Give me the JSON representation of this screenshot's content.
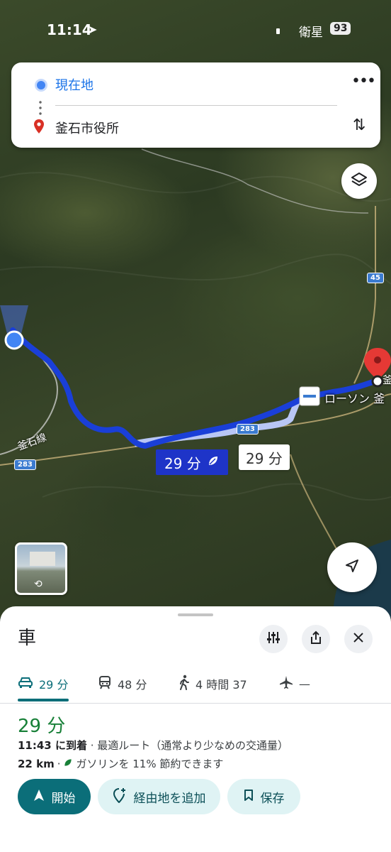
{
  "status_bar": {
    "time": "11:14",
    "carrier": "衛星",
    "battery": "93"
  },
  "directions": {
    "origin": "現在地",
    "destination": "釜石市役所",
    "more_label": "•••"
  },
  "map": {
    "route_primary_time": "29 分",
    "route_alt_time": "29 分",
    "poi_label": "ローソン 釜",
    "dest_label": "釜",
    "rail_label": "釜石線",
    "shield_283_a": "283",
    "shield_283_b": "283",
    "shield_45": "45"
  },
  "sheet": {
    "mode_title": "車",
    "tabs": [
      {
        "icon": "car-icon",
        "label": "29 分"
      },
      {
        "icon": "train-icon",
        "label": "48 分"
      },
      {
        "icon": "walk-icon",
        "label": "4 時間 37"
      },
      {
        "icon": "plane-icon",
        "label": "—"
      }
    ],
    "duration": "29 分",
    "arrival_time": "11:43 に到着",
    "arrival_note": " · 最適ルート（通常より少なめの交通量）",
    "distance": "22 km",
    "eco_note": "ガソリンを 11% 節約できます",
    "buttons": {
      "start": "開始",
      "add_stop": "経由地を追加",
      "save": "保存"
    }
  },
  "colors": {
    "route_primary": "#1a3fd8",
    "route_alt": "#b8c6f5",
    "accent_teal": "#0b6e79",
    "duration_green": "#188038"
  }
}
